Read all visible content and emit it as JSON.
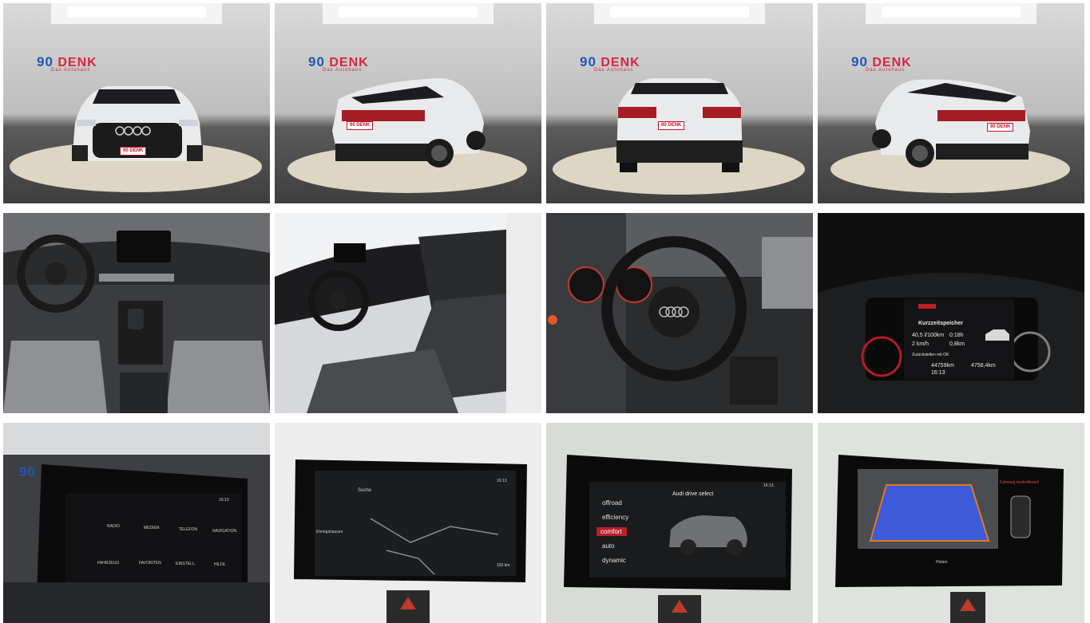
{
  "dealer": {
    "number": "90",
    "name": "DENK",
    "tagline": "Das Autohaus"
  },
  "photos": [
    {
      "label": "exterior-front"
    },
    {
      "label": "exterior-rear-left"
    },
    {
      "label": "exterior-rear"
    },
    {
      "label": "exterior-rear-right"
    },
    {
      "label": "interior-dashboard"
    },
    {
      "label": "interior-driver-side"
    },
    {
      "label": "interior-steering-wheel"
    },
    {
      "label": "virtual-cockpit"
    },
    {
      "label": "mmi-home-menu"
    },
    {
      "label": "mmi-navigation"
    },
    {
      "label": "mmi-drive-select"
    },
    {
      "label": "mmi-rear-camera"
    }
  ],
  "cockpit": {
    "header": "Kurzzeitspeicher",
    "consumption": "40,5 l/100km",
    "duration": "0:18h",
    "speed": "2 km/h",
    "distance": "0,8km",
    "start_label": "Zurückstellen mit OK",
    "odometer": "44759km",
    "trip": "4758,4km",
    "time": "16:13"
  },
  "home_menu": {
    "time": "16:13",
    "items": [
      "RADIO",
      "MEDIEN",
      "TELEFON",
      "NAVIGATION",
      "FAHRZEUG",
      "FAVORITEN",
      "EINSTELL.",
      "HILFE"
    ]
  },
  "navigation": {
    "search_label": "Suche",
    "time": "16:13",
    "place": "Ehringshausen",
    "distance": "153 km"
  },
  "drive_select": {
    "title": "Audi drive select",
    "time": "16:13",
    "modes": [
      "offroad",
      "efficiency",
      "comfort",
      "auto",
      "dynamic"
    ],
    "selected": "comfort"
  },
  "rear_camera": {
    "warning": "Fahrweg kontrollieren!",
    "footer": "Hinten"
  },
  "colors": {
    "brand_red": "#d7263d",
    "brand_blue": "#1f56b9",
    "audi_red": "#b81f2a"
  }
}
